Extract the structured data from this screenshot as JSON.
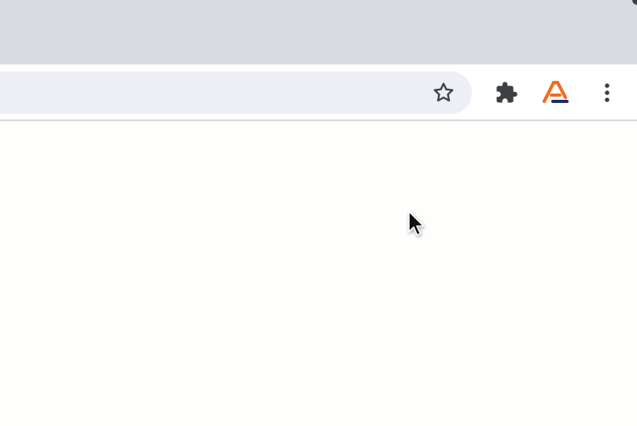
{
  "browser": {
    "toolbar": {
      "omnibox": {
        "value": "",
        "placeholder": ""
      },
      "buttons": [
        {
          "name": "bookmark-star",
          "icon": "star-outline-icon"
        },
        {
          "name": "extensions",
          "icon": "puzzle-piece-icon"
        },
        {
          "name": "extension-a",
          "icon": "orange-a-logo-icon"
        },
        {
          "name": "menu",
          "icon": "vertical-dots-icon"
        }
      ]
    },
    "colors": {
      "tab_strip": "#d8dbdf",
      "omnibox": "#eeeff5",
      "toolbar": "#ffffff",
      "page": "#fefefc",
      "icon": "#3c4043",
      "logo_orange": "#f26b21",
      "logo_navy": "#1f2a6b"
    }
  },
  "page": {
    "content": ""
  }
}
